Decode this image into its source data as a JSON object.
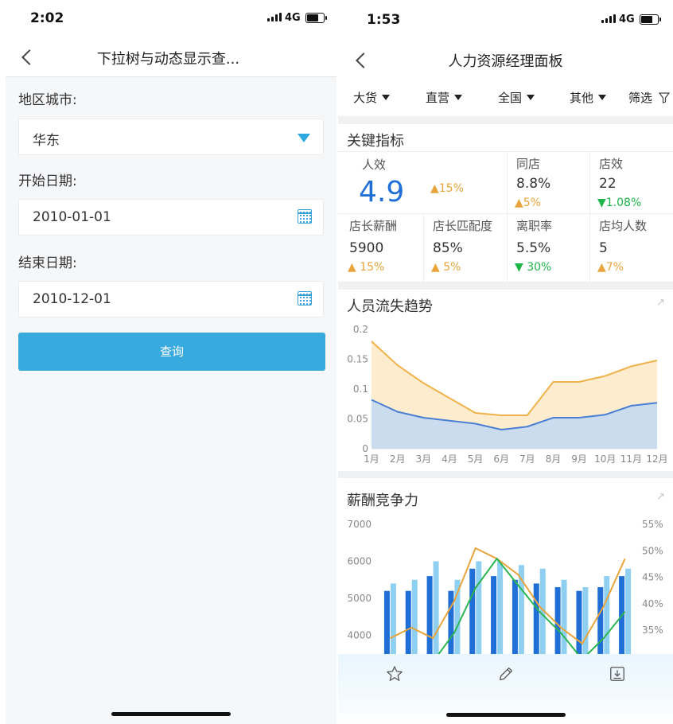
{
  "left": {
    "status": {
      "time": "2:02",
      "network": "4G"
    },
    "title": "下拉树与动态显示查...",
    "fields": [
      {
        "label": "地区城市:",
        "value": "华东"
      },
      {
        "label": "开始日期:",
        "value": "2010-01-01"
      },
      {
        "label": "结束日期:",
        "value": "2010-12-01"
      }
    ],
    "query_label": "查询"
  },
  "right": {
    "status": {
      "time": "1:53",
      "network": "4G"
    },
    "title": "人力资源经理面板",
    "filters": [
      "大货",
      "直营",
      "全国",
      "其他",
      "筛选"
    ],
    "kpi_title": "关键指标",
    "kpis": [
      {
        "name": "人效",
        "value": "4.9",
        "change": "▲15%",
        "dir": "up"
      },
      {
        "name": "同店",
        "value": "8.8%",
        "change": "▲5%",
        "dir": "up"
      },
      {
        "name": "店效",
        "value": "22",
        "change": "▼1.08%",
        "dir": "down"
      },
      {
        "name": "店长薪酬",
        "value": "5900",
        "change": "▲ 15%",
        "dir": "up"
      },
      {
        "name": "店长匹配度",
        "value": "85%",
        "change": "▲ 5%",
        "dir": "up"
      },
      {
        "name": "离职率",
        "value": "5.5%",
        "change": "▼ 30%",
        "dir": "down"
      },
      {
        "name": "店均人数",
        "value": "5",
        "change": "▲7%",
        "dir": "up"
      }
    ],
    "colors": {
      "up": "#e9a43c",
      "down": "#20b54a",
      "accent": "#38aade",
      "kpi_big": "#1f6fd6"
    }
  },
  "chart_data": [
    {
      "type": "area",
      "title": "人员流失趋势",
      "categories": [
        "1月",
        "2月",
        "3月",
        "4月",
        "5月",
        "6月",
        "7月",
        "8月",
        "9月",
        "10月",
        "11月",
        "12月"
      ],
      "series": [
        {
          "values": [
            0.18,
            0.14,
            0.11,
            0.085,
            0.06,
            0.056,
            0.056,
            0.112,
            0.112,
            0.122,
            0.138,
            0.148
          ]
        },
        {
          "values": [
            0.082,
            0.062,
            0.052,
            0.047,
            0.042,
            0.032,
            0.037,
            0.052,
            0.052,
            0.057,
            0.072,
            0.077
          ]
        }
      ],
      "yticks": [
        "0",
        "0.05",
        "0.1",
        "0.15",
        "0.2"
      ],
      "ylim": [
        0,
        0.2
      ],
      "colors": [
        "#f0b24a",
        "#4a7fd4"
      ]
    },
    {
      "type": "bar",
      "title": "薪酬竞争力",
      "yticks_left": [
        "4000",
        "5000",
        "6000",
        "7000"
      ],
      "yticks_right": [
        "35%",
        "40%",
        "45%",
        "50%",
        "55%"
      ],
      "ylim_left": [
        3500,
        7000
      ],
      "ylim_right": [
        0.3,
        0.55
      ],
      "series": [
        {
          "values": [
            5200,
            5200,
            5600,
            5200,
            5800,
            5600,
            5500,
            5400,
            5300,
            5200,
            5300,
            5600
          ],
          "color": "#1f6fd6"
        },
        {
          "values": [
            5400,
            5500,
            6000,
            5500,
            6000,
            6000,
            5900,
            5800,
            5500,
            5300,
            5600,
            5800
          ],
          "color": "#8fd0f2"
        },
        {
          "values": [
            0.335,
            0.355,
            0.335,
            0.405,
            0.505,
            0.485,
            0.455,
            0.395,
            0.355,
            0.325,
            0.395,
            0.485
          ],
          "color": "#e9a43c",
          "axis": "right"
        },
        {
          "values": [
            0.22,
            0.22,
            0.29,
            0.345,
            0.43,
            0.485,
            0.435,
            0.385,
            0.345,
            0.295,
            0.335,
            0.385
          ],
          "color": "#2ab550",
          "axis": "right"
        }
      ]
    }
  ]
}
